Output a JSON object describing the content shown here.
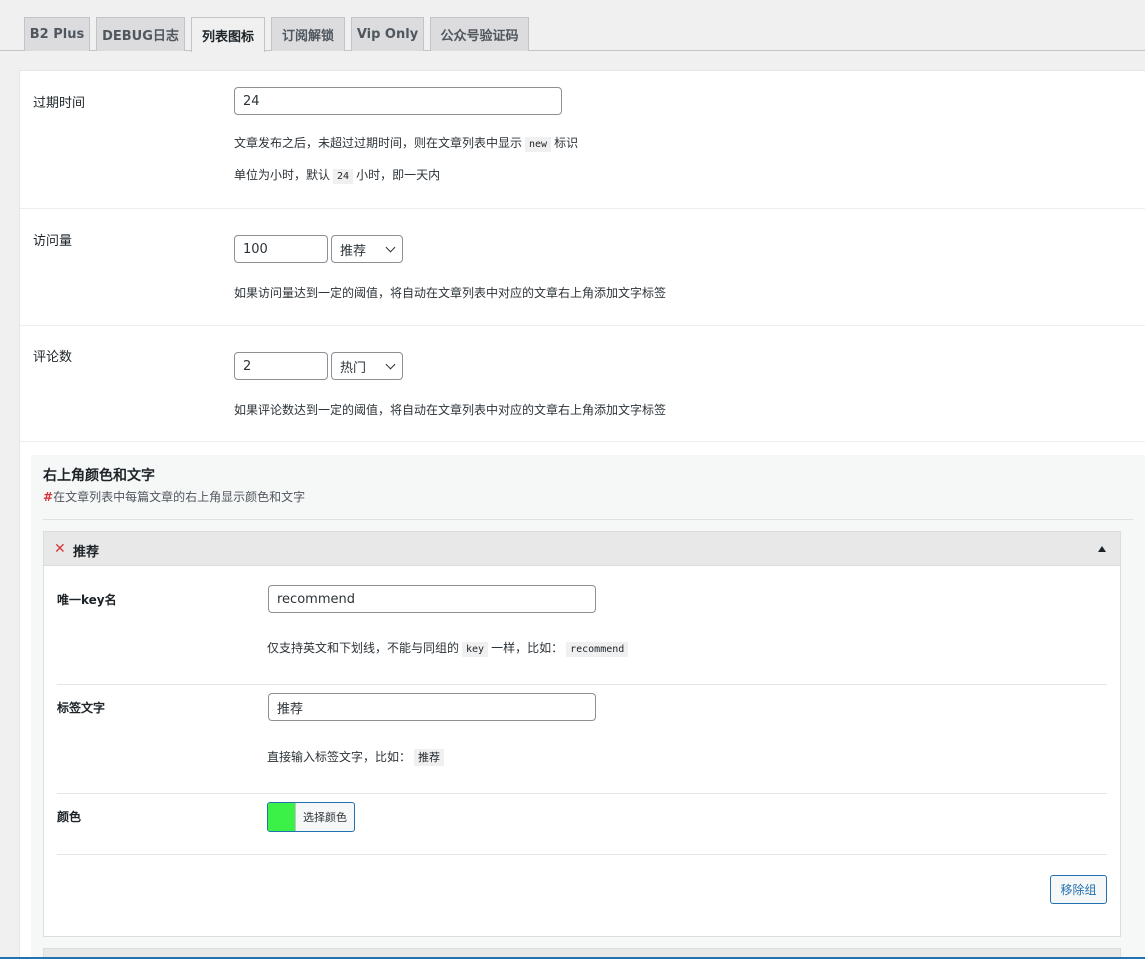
{
  "tabs": [
    {
      "label": "B2 Plus"
    },
    {
      "label": "DEBUG日志"
    },
    {
      "label": "列表图标"
    },
    {
      "label": "订阅解锁"
    },
    {
      "label": "Vip Only"
    },
    {
      "label": "公众号验证码"
    }
  ],
  "active_tab": "列表图标",
  "expire": {
    "label": "过期时间",
    "value": "24",
    "desc1_pre": "文章发布之后，未超过过期时间，则在文章列表中显示",
    "desc1_code": "new",
    "desc1_post": "标识",
    "desc2_pre": "单位为小时，默认",
    "desc2_code": "24",
    "desc2_post": "小时，即一天内"
  },
  "views": {
    "label": "访问量",
    "value": "100",
    "select": "推荐",
    "desc": "如果访问量达到一定的阈值，将自动在文章列表中对应的文章右上角添加文字标签"
  },
  "comments": {
    "label": "评论数",
    "value": "2",
    "select": "热门",
    "desc": "如果评论数达到一定的阈值，将自动在文章列表中对应的文章右上角添加文字标签"
  },
  "group": {
    "title": "右上角颜色和文字",
    "subtitle_hash": "#",
    "subtitle": "在文章列表中每篇文章的右上角显示颜色和文字",
    "card": {
      "title": "推荐",
      "key_label": "唯一key名",
      "key_value": "recommend",
      "key_desc_pre": "仅支持英文和下划线，不能与同组的",
      "key_desc_code1": "key",
      "key_desc_mid": "一样，比如：",
      "key_desc_code2": "recommend",
      "text_label": "标签文字",
      "text_value": "推荐",
      "text_desc_pre": "直接输入标签文字，比如：",
      "text_desc_code": "推荐",
      "color_label": "颜色",
      "color_btn": "选择颜色",
      "color_value": "#3bf148",
      "remove_btn": "移除组"
    }
  },
  "colors": {
    "accent": "#2271b1",
    "danger": "#d63638"
  }
}
